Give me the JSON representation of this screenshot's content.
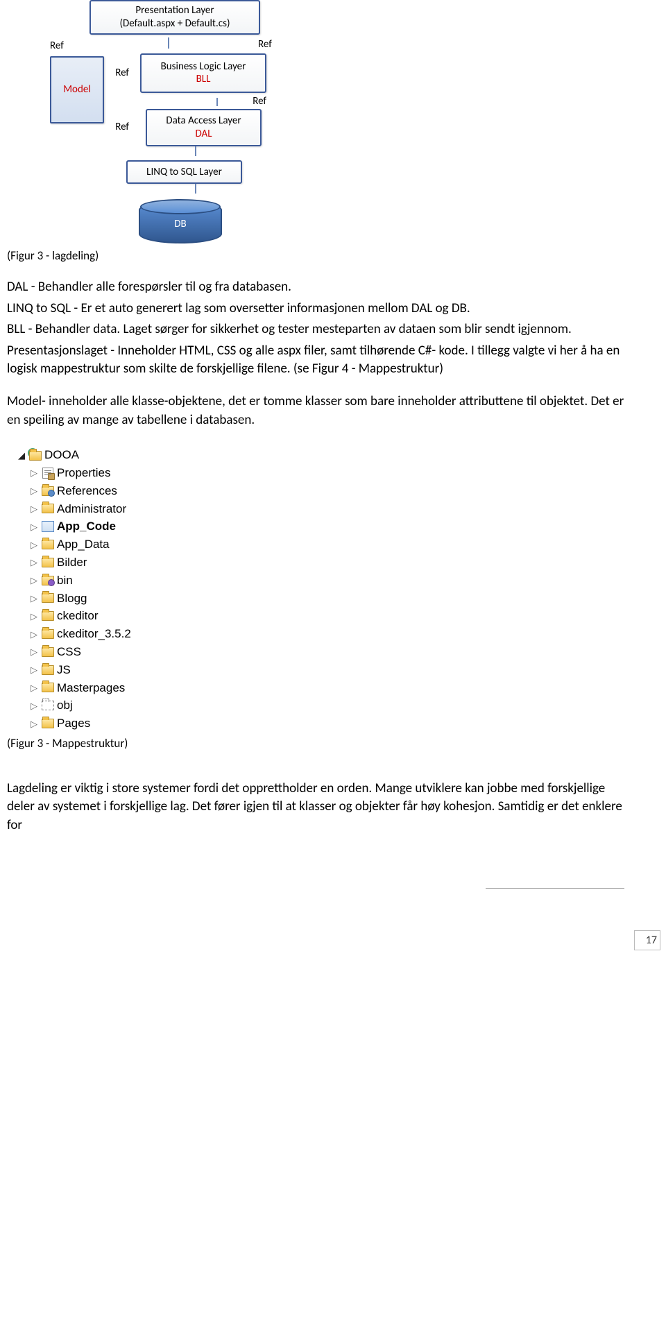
{
  "diagram": {
    "presentation_line1": "Presentation Layer",
    "presentation_line2": "(Default.aspx + Default.cs)",
    "ref": "Ref",
    "model": "Model",
    "bll_line1": "Business Logic Layer",
    "bll_line2": "BLL",
    "dal_line1": "Data Access Layer",
    "dal_line2": "DAL",
    "linq": "LINQ to SQL Layer",
    "db": "DB"
  },
  "caption1": "(Figur 3 - lagdeling)",
  "body": {
    "p1": "DAL - Behandler alle forespørsler til og fra databasen.",
    "p2": "LINQ to SQL - Er et auto generert lag som oversetter informasjonen mellom DAL og DB.",
    "p3": "BLL - Behandler data. Laget sørger for sikkerhet og tester mesteparten av dataen som blir sendt igjennom.",
    "p4": "Presentasjonslaget - Inneholder HTML, CSS og alle aspx filer, samt tilhørende C#- kode. I tillegg valgte vi her å ha en logisk mappestruktur som skilte de forskjellige filene. (se Figur 4 - Mappestruktur)",
    "p5": "Model- inneholder alle klasse-objektene, det er tomme klasser som bare inneholder attributtene til objektet. Det er en speiling av mange av tabellene i databasen.",
    "p6": "Lagdeling er viktig i store systemer fordi det opprettholder en orden. Mange utviklere kan jobbe med forskjellige deler av systemet i forskjellige lag. Det fører igjen til at klasser og objekter får høy kohesjon. Samtidig er det enklere for"
  },
  "tree": {
    "root": "DOOA",
    "items": [
      {
        "label": "Properties",
        "icon": "prop"
      },
      {
        "label": "References",
        "icon": "ref"
      },
      {
        "label": "Administrator",
        "icon": "folder"
      },
      {
        "label": "App_Code",
        "icon": "cs",
        "bold": true
      },
      {
        "label": "App_Data",
        "icon": "folder"
      },
      {
        "label": "Bilder",
        "icon": "folder"
      },
      {
        "label": "bin",
        "icon": "bin"
      },
      {
        "label": "Blogg",
        "icon": "folder"
      },
      {
        "label": "ckeditor",
        "icon": "folder"
      },
      {
        "label": "ckeditor_3.5.2",
        "icon": "folder"
      },
      {
        "label": "CSS",
        "icon": "folder"
      },
      {
        "label": "JS",
        "icon": "folder"
      },
      {
        "label": "Masterpages",
        "icon": "folder"
      },
      {
        "label": "obj",
        "icon": "ghost"
      },
      {
        "label": "Pages",
        "icon": "folder"
      }
    ]
  },
  "caption2": "(Figur 3 - Mappestruktur)",
  "page_number": "17"
}
